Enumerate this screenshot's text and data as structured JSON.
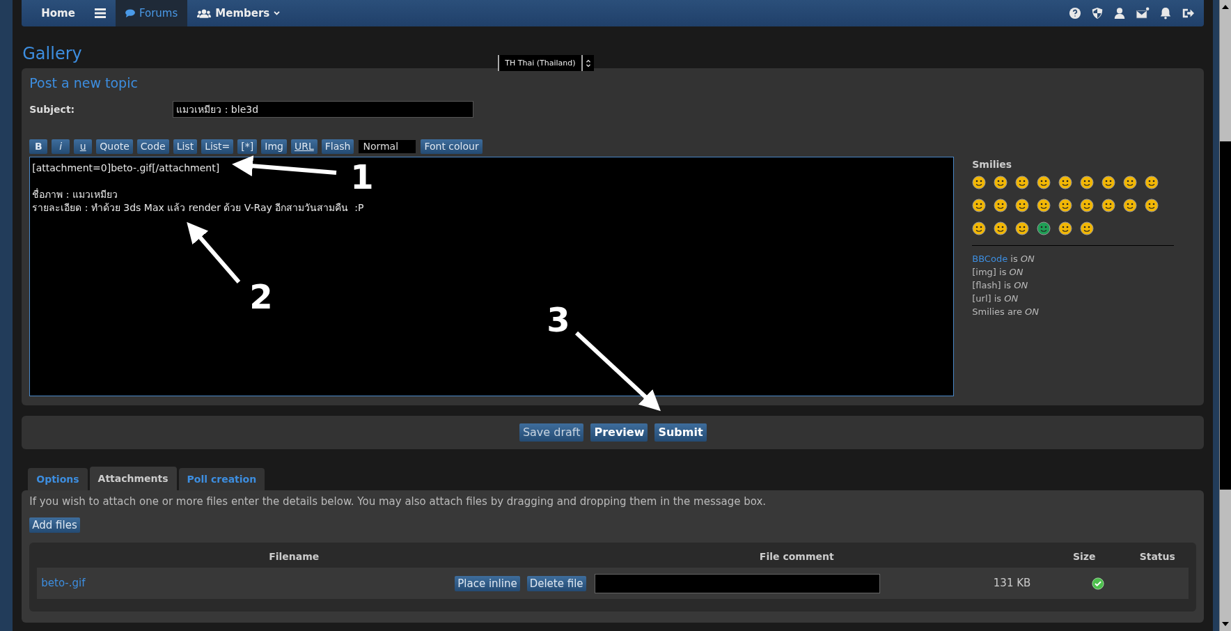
{
  "nav": {
    "items": [
      {
        "label": "Home",
        "selected": false,
        "kind": "text"
      },
      {
        "selected": false,
        "kind": "menu"
      },
      {
        "label": "Forums",
        "selected": true,
        "kind": "forums"
      },
      {
        "label": "Members",
        "selected": false,
        "kind": "members"
      }
    ]
  },
  "page_title": "Gallery",
  "language_select": {
    "value": "TH Thai (Thailand)"
  },
  "post": {
    "title": "Post a new topic",
    "subject_label": "Subject:",
    "subject_value": "แมวเหมียว : ble3d",
    "toolbar": [
      {
        "label": "B",
        "kind": "bold"
      },
      {
        "label": "i",
        "kind": "italic"
      },
      {
        "label": "u",
        "kind": "underline"
      },
      {
        "label": "Quote",
        "kind": "plain"
      },
      {
        "label": "Code",
        "kind": "plain"
      },
      {
        "label": "List",
        "kind": "plain"
      },
      {
        "label": "List=",
        "kind": "plain"
      },
      {
        "label": "[*]",
        "kind": "plain"
      },
      {
        "label": "Img",
        "kind": "plain"
      },
      {
        "label": "URL",
        "kind": "underline"
      },
      {
        "label": "Flash",
        "kind": "plain"
      },
      {
        "label": "Normal",
        "kind": "select"
      },
      {
        "label": "Font colour",
        "kind": "plain"
      }
    ],
    "message_paragraphs": [
      [
        "[attachment=0]beto-.gif[/attachment]"
      ],
      [
        "ชื่อภาพ : แมวเหมียว",
        "รายละเอียด : ทำด้วย 3ds Max แล้ว render ด้วย V-Ray อีกสามวันสามคืน  :P"
      ]
    ],
    "smilies_title": "Smilies",
    "smilies": [
      {
        "color": "#f2b705"
      },
      {
        "color": "#f2b705"
      },
      {
        "color": "#f2b705"
      },
      {
        "color": "#f2b705"
      },
      {
        "color": "#f2b705"
      },
      {
        "color": "#f2b705"
      },
      {
        "color": "#f2b705"
      },
      {
        "color": "#f2b705"
      },
      {
        "color": "#f2b705"
      },
      {
        "color": "#f2b705"
      },
      {
        "color": "#f2b705"
      },
      {
        "color": "#f2b705"
      },
      {
        "color": "#f2b705"
      },
      {
        "color": "#f2b705"
      },
      {
        "color": "#f2b705"
      },
      {
        "color": "#f2b705"
      },
      {
        "color": "#f2b705"
      },
      {
        "color": "#f2b705"
      },
      {
        "color": "#f2b705"
      },
      {
        "color": "#f2b705"
      },
      {
        "color": "#f2b705"
      },
      {
        "color": "#1f9e55"
      },
      {
        "color": "#f2b705"
      },
      {
        "color": "#f2b705"
      }
    ],
    "status_lines": [
      "**BBCode** is *ON*",
      "[img] is *ON*",
      "[flash] is *ON*",
      "[url] is *ON*",
      "Smilies are *ON*"
    ]
  },
  "actions": [
    {
      "label": "Save draft",
      "kind": "plain"
    },
    {
      "label": "Preview",
      "kind": "bold"
    },
    {
      "label": "Submit",
      "kind": "bold"
    }
  ],
  "tabs": [
    {
      "label": "Options",
      "selected": false
    },
    {
      "label": "Attachments",
      "selected": true
    },
    {
      "label": "Poll creation",
      "selected": false
    }
  ],
  "attachments": {
    "intro": "If you wish to attach one or more files enter the details below. You may also attach files by dragging and dropping them in the message box.",
    "add_button": "Add files",
    "columns": [
      "Filename",
      "File comment",
      "Size",
      "Status"
    ],
    "rows": [
      {
        "filename": "beto-.gif",
        "place_inline": "Place inline",
        "delete": "Delete file",
        "size": "131 KB",
        "status_ok": true
      }
    ]
  },
  "annotations": [
    "1",
    "2",
    "3"
  ]
}
